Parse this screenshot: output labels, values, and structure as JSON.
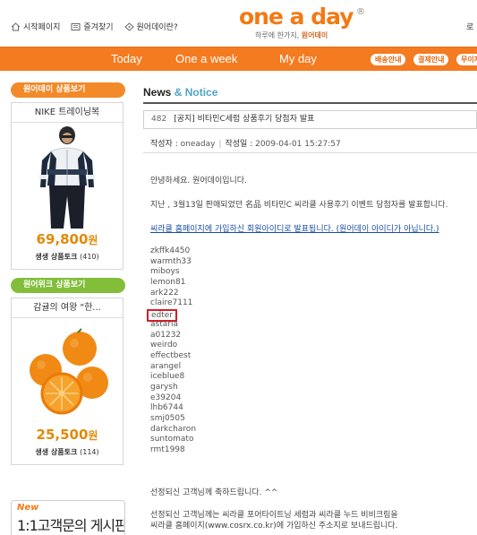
{
  "header": {
    "links": [
      {
        "label": "시작페이지",
        "icon": "home-icon"
      },
      {
        "label": "즐겨찾기",
        "icon": "bookmark-icon"
      },
      {
        "label": "원어데이란?",
        "icon": "question-icon"
      }
    ],
    "logo": "one a day",
    "logo_reg": "®",
    "tagline_prefix": "하루에 한가지, ",
    "tagline_brand": "원어데이",
    "login_stub": "로"
  },
  "nav": {
    "items": [
      "Today",
      "One a week",
      "My day"
    ],
    "pills": [
      "배송안내",
      "결제안내",
      "무이자"
    ]
  },
  "sidebar": {
    "sections": [
      {
        "heading": "원어데이 상품보기",
        "title": "NIKE 트레이닝복",
        "price": "69,800",
        "price_unit": "원",
        "talk_label": "생생 상품토크",
        "talk_count": "(410)"
      },
      {
        "heading": "원어위크 상품보기",
        "title": "감귤의 여왕 \"한...",
        "price": "25,500",
        "price_unit": "원",
        "talk_label": "생생 상품토크",
        "talk_count": "(114)"
      }
    ],
    "promo_new": "New",
    "promo_text": "1:1고객문의 게시판"
  },
  "main": {
    "heading_a": "News",
    "heading_amp": " & ",
    "heading_b": "Notice",
    "post_number": "482",
    "post_subject": "[공지] 비타민C세럼 상품후기 당첨자 발표",
    "author_label": "작성자",
    "author_value": "oneaday",
    "date_label": "작성일",
    "date_value": "2009-04-01 15:27:57",
    "greeting": "안녕하세요. 원어데이입니다.",
    "announcement": "지난 , 3월13일 판매되었던 名品 비타민C 씨라클 사용후기 이벤트 당첨자를 발표합니다.",
    "link_text": "씨라클 홈페이지에 가입하신 회원아이디로 발표됩니다. (원어데이 아이디가 아닙니다.)",
    "winners": [
      "zkffk4450",
      "warmth33",
      "miboys",
      "lemon81",
      "ark222",
      "claire7111",
      "edter",
      "astaria",
      "a01232",
      "weirdo",
      "effectbest",
      "arangel",
      "iceblue8",
      "garysh",
      "e39204",
      "lhb6744",
      "smj0505",
      "darkcharon",
      "suntomato",
      "rmt1998"
    ],
    "highlighted_winner": "edter",
    "congrats": "선정되신 고객님께 축하드립니다. ^^",
    "footer_line1": "선정되신 고객님께는 씨라클 포어타이트닝 세럼과 씨라클 누드 비비크림을",
    "footer_line2": "씨라클 홈페이지(www.cosrx.co.kr)에 가입하신 주소지로 보내드립니다."
  },
  "colors": {
    "brand_orange": "#f47b20",
    "section_green": "#82be3a",
    "price_orange": "#e08a0a",
    "link_blue": "#1a4ea0",
    "highlight_red": "#d21f2a",
    "notice_blue": "#4fa3c7"
  }
}
